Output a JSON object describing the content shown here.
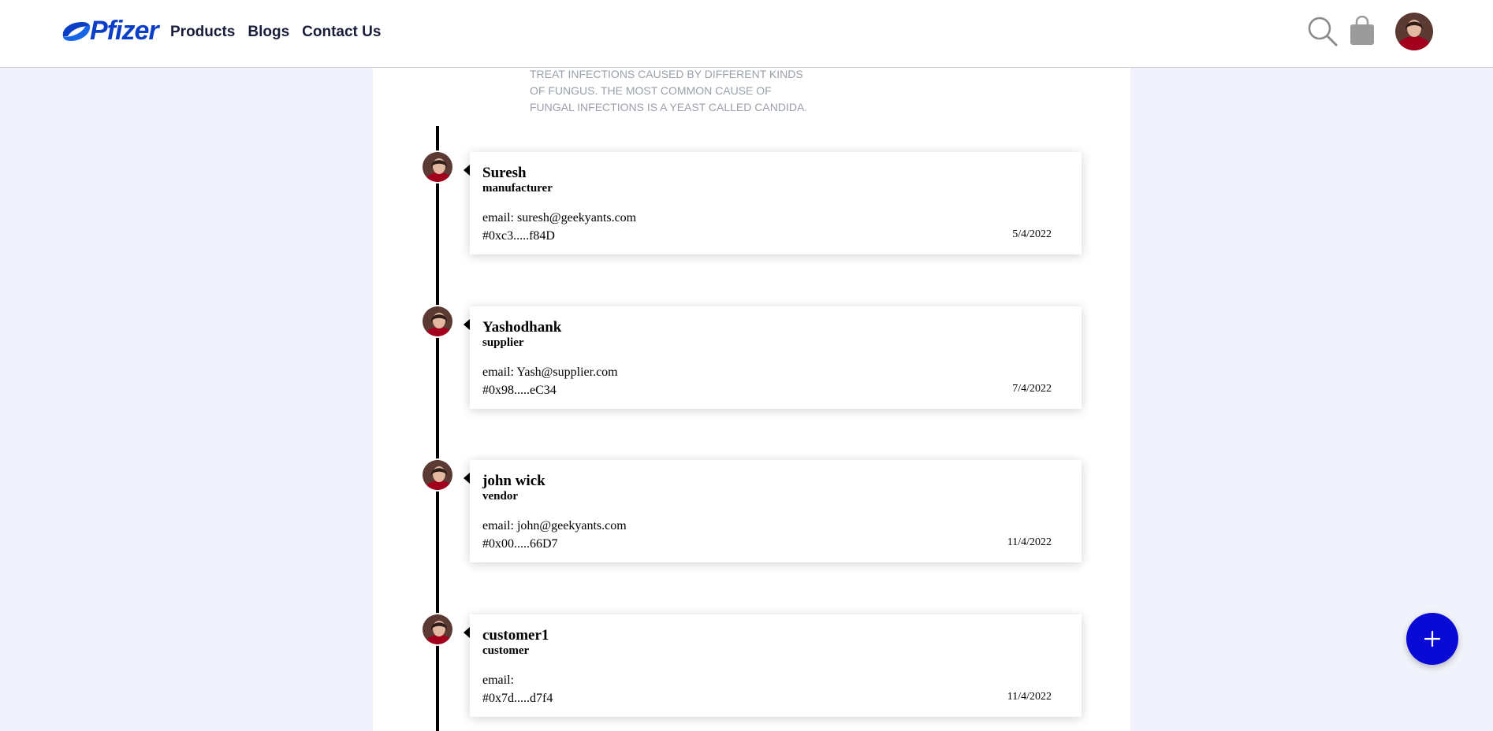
{
  "header": {
    "logo_text": "Pfizer",
    "nav": [
      "Products",
      "Blogs",
      "Contact Us"
    ],
    "brand_color": "#0a3ec7"
  },
  "product": {
    "description": "TREAT INFECTIONS CAUSED BY DIFFERENT KINDS OF FUNGUS. THE MOST COMMON CAUSE OF FUNGAL INFECTIONS IS A YEAST CALLED CANDIDA."
  },
  "timeline": [
    {
      "name": "Suresh",
      "role": "manufacturer",
      "email": "email: suresh@geekyants.com",
      "hash": "#0xc3.....f84D",
      "date": "5/4/2022"
    },
    {
      "name": "Yashodhank",
      "role": "supplier",
      "email": "email: Yash@supplier.com",
      "hash": "#0x98.....eC34",
      "date": "7/4/2022"
    },
    {
      "name": "john wick",
      "role": "vendor",
      "email": "email: john@geekyants.com",
      "hash": "#0x00.....66D7",
      "date": "11/4/2022"
    },
    {
      "name": "customer1",
      "role": "customer",
      "email": "email:",
      "hash": "#0x7d.....d7f4",
      "date": "11/4/2022"
    }
  ],
  "fab": {
    "icon": "plus-icon",
    "color": "#0a0ad6"
  }
}
